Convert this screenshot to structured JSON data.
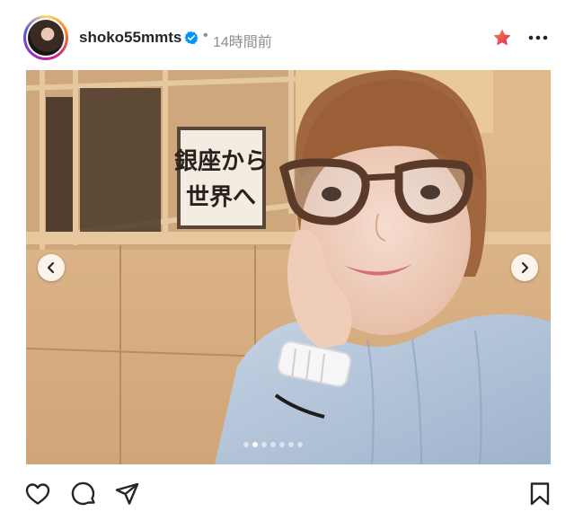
{
  "post": {
    "username": "shoko55mmts",
    "verified": true,
    "separator": "•",
    "time_ago": "14時間前",
    "sign_text": "銀座から世界へ"
  },
  "icons": {
    "avatar": "profile-photo",
    "verified": "verified-badge-icon",
    "star": "star-icon",
    "more": "more-options-icon",
    "prev": "chevron-left-icon",
    "next": "chevron-right-icon",
    "like": "heart-icon",
    "comment": "comment-icon",
    "share": "paper-plane-icon",
    "save": "bookmark-icon"
  },
  "carousel": {
    "total_slides": 7,
    "active_slide": 2
  },
  "colors": {
    "verified_blue": "#0095f6",
    "star_gradient_start": "#f58529",
    "star_gradient_end": "#dd2a7b",
    "icon_color": "#262626",
    "muted_text": "#8e8e8e"
  }
}
